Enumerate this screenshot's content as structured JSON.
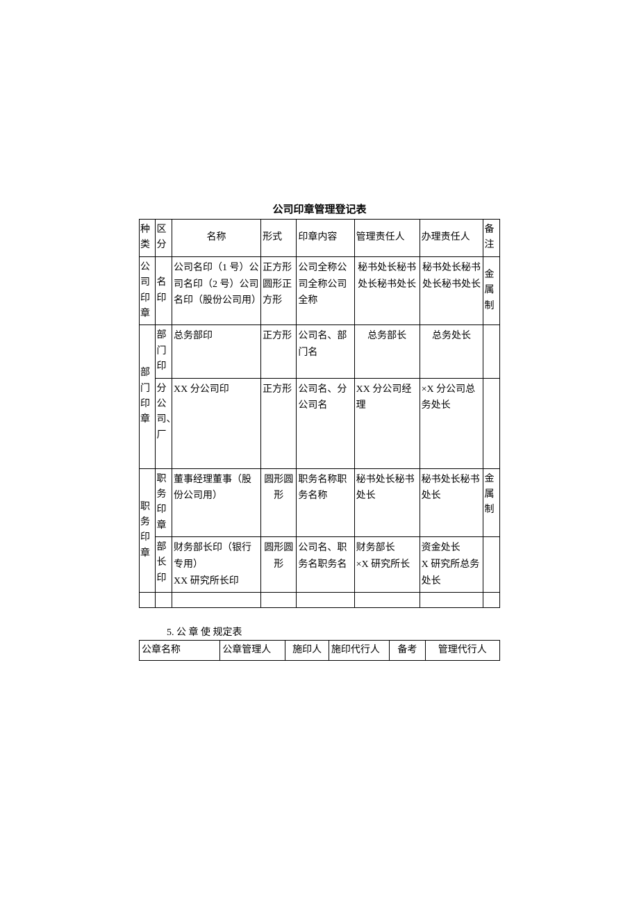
{
  "table1": {
    "title": "公司印章管理登记表",
    "headers": {
      "kind": "种类",
      "division": "区分",
      "name": "名称",
      "form": "形式",
      "content": "印章内容",
      "manager": "管理责任人",
      "handler": "办理责任人",
      "note": "备注"
    },
    "rows": [
      {
        "kind": "公司印章",
        "division": "名印",
        "name": "公司名印（1 号）公司名印（2 号）公司名印（股份公司用）",
        "form": "正方形圆形正方形",
        "content": "公司全称公司全称公司全称",
        "manager": "秘书处长秘书处长秘书处长",
        "handler": "秘书处长秘书处长秘书处长",
        "note": "金属制"
      },
      {
        "kind": "部门印章",
        "division": "部门印",
        "name": "总务部印",
        "form": "正方形",
        "content": "公司名、部门名",
        "manager": "总务部长",
        "handler": "总务处长",
        "note": ""
      },
      {
        "kind": "",
        "division": "分公司、厂",
        "name": "XX 分公司印",
        "form": "正方形",
        "content": "公司名、分公司名",
        "manager": "XX 分公司经理",
        "handler": "×X 分公司总务处长",
        "note": ""
      },
      {
        "kind": "职务印章",
        "division": "职务印章",
        "name": "董事经理董事（股份公司用）",
        "form": "圆形圆形",
        "content": "职务名称职务名称",
        "manager": "秘书处长秘书处长",
        "handler": "秘书处长秘书处长",
        "note": "金属制"
      },
      {
        "kind": "",
        "division": "部长印",
        "name": "财务部长印（银行专用）\nXX 研究所长印",
        "form": "圆形圆形",
        "content": "公司名、职务名职务名",
        "manager": "财务部长\n×X 研究所长",
        "handler": "资金处长\nX 研究所总务处长",
        "note": ""
      }
    ]
  },
  "section2_label": "5. 公 章 使 规定表",
  "table2": {
    "headers": {
      "seal_name": "公章名称",
      "manager": "公章管理人",
      "stamper": "施印人",
      "stamp_proxy": "施印代行人",
      "remark": "备考",
      "mgmt_proxy": "管理代行人"
    }
  }
}
